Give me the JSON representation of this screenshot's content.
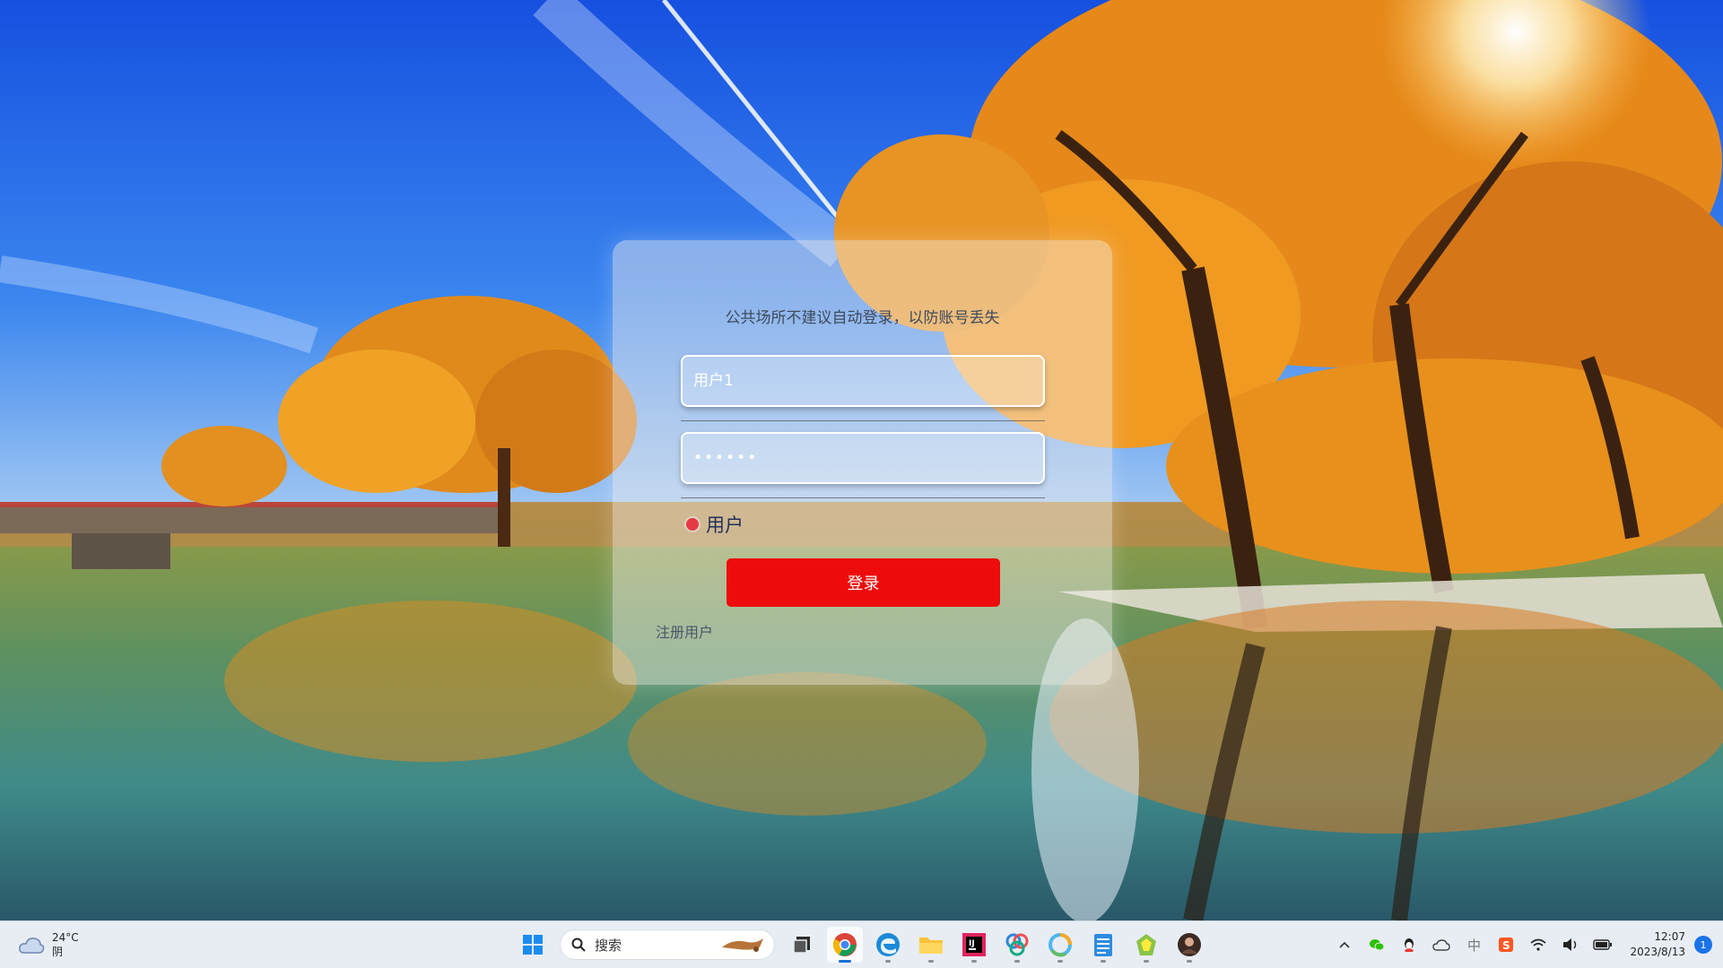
{
  "login": {
    "notice": "公共场所不建议自动登录，以防账号丢失",
    "username_value": "用户1",
    "password_value": "••••••",
    "role_label": "用户",
    "login_button": "登录",
    "register_link": "注册用户",
    "accent_color": "#ee0b0b"
  },
  "taskbar": {
    "weather": {
      "temp": "24°C",
      "condition": "阴",
      "icon": "cloud-icon"
    },
    "search_placeholder": "搜索",
    "apps": [
      {
        "name": "start-icon"
      },
      {
        "name": "task-view-icon"
      },
      {
        "name": "chrome-icon",
        "active": true
      },
      {
        "name": "edge-icon"
      },
      {
        "name": "file-explorer-icon"
      },
      {
        "name": "jetbrains-icon"
      },
      {
        "name": "app-colorful-icon"
      },
      {
        "name": "app-ring-icon"
      },
      {
        "name": "notepad-icon"
      },
      {
        "name": "app-green-icon"
      },
      {
        "name": "avatar-app-icon"
      }
    ],
    "tray": {
      "ime_label": "中",
      "clock_time": "12:07",
      "clock_date": "2023/8/13",
      "notification_count": "1"
    }
  }
}
